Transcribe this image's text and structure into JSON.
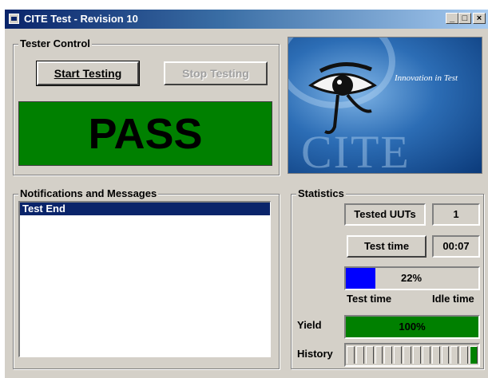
{
  "window": {
    "title": "CITE Test - Revision 10",
    "controls": {
      "minimize": "_",
      "maximize": "□",
      "close": "×"
    }
  },
  "tester_control": {
    "label": "Tester Control",
    "start_button": "Start Testing",
    "stop_button": "Stop Testing",
    "status": "PASS",
    "status_color": "#008000"
  },
  "logo": {
    "tagline": "Innovation in Test",
    "word": "CITE",
    "eye_icon": "eye-icon"
  },
  "notifications": {
    "label": "Notifications and Messages",
    "messages": [
      "Test End"
    ]
  },
  "statistics": {
    "label": "Statistics",
    "tested_uuts_label": "Tested UUTs",
    "tested_uuts_value": "1",
    "test_time_label": "Test time",
    "test_time_value": "00:07",
    "progress_percent": 22,
    "progress_text": "22%",
    "progress_color": "#0000ff",
    "left_caption": "Test time",
    "right_caption": "Idle time",
    "yield_label": "Yield",
    "yield_text": "100%",
    "yield_color": "#008000",
    "history_label": "History",
    "history_slots": 14,
    "history_passed": 1
  }
}
